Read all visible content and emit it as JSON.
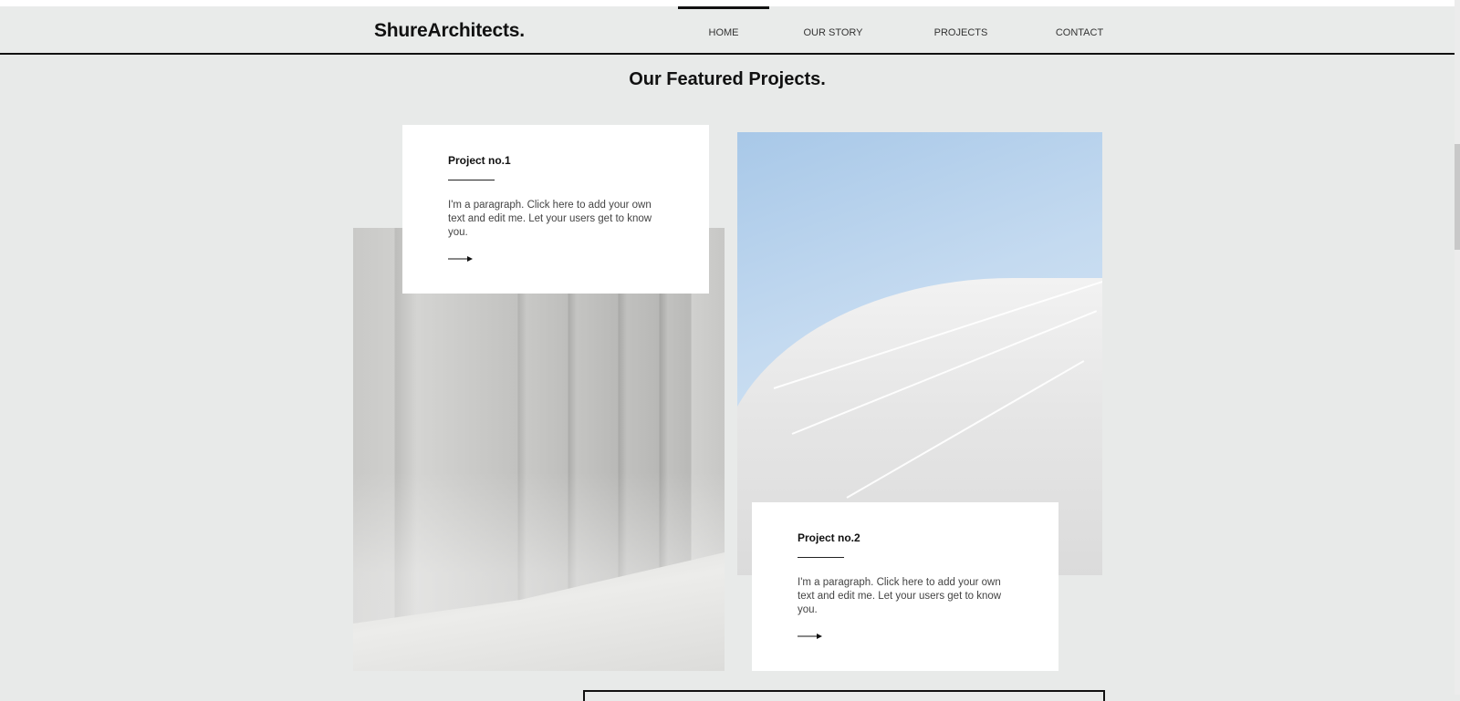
{
  "header": {
    "logo": "ShureArchitects.",
    "nav": [
      "HOME",
      "OUR STORY",
      "PROJECTS",
      "CONTACT"
    ],
    "active_nav": "HOME"
  },
  "main": {
    "title": "Our Featured Projects.",
    "projects": [
      {
        "title": "Project no.1",
        "text": "I'm a paragraph. Click here to add your own text and edit me. Let your users get to know you."
      },
      {
        "title": "Project no.2",
        "text": "I'm a paragraph. Click here to add your own text and edit me. Let your users get to know you."
      }
    ]
  },
  "icons": {
    "arrow": "arrow-right-icon"
  },
  "colors": {
    "background": "#e8eae9",
    "text": "#111111",
    "card": "#ffffff"
  }
}
